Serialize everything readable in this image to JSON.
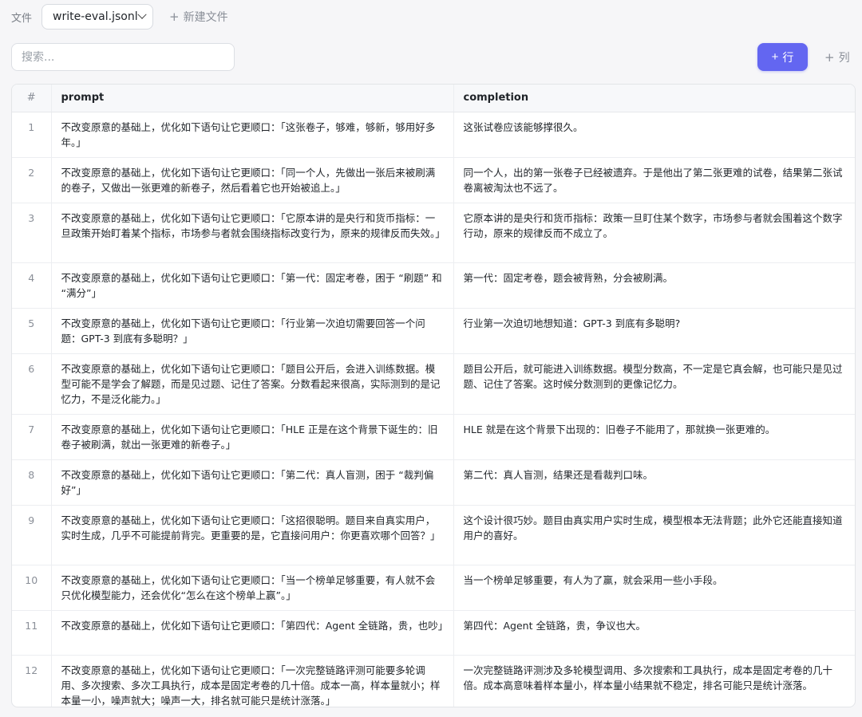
{
  "filebar": {
    "label": "文件",
    "selected_file": "write-eval.jsonl",
    "new_file_label": "新建文件"
  },
  "toolbar": {
    "search_placeholder": "搜索...",
    "add_row_label": "行",
    "add_col_label": "列"
  },
  "colors": {
    "accent": "#6366f1"
  },
  "table": {
    "headers": {
      "num": "#",
      "prompt": "prompt",
      "completion": "completion"
    },
    "rows": [
      {
        "num": "1",
        "prompt": "不改变原意的基础上，优化如下语句让它更顺口：「这张卷子，够难，够新，够用好多年。」",
        "completion": "这张试卷应该能够撑很久。"
      },
      {
        "num": "2",
        "prompt": "不改变原意的基础上，优化如下语句让它更顺口：「同一个人，先做出一张后来被刷满的卷子，又做出一张更难的新卷子，然后看着它也开始被追上。」",
        "completion": "同一个人，出的第一张卷子已经被遗弃。于是他出了第二张更难的试卷，结果第二张试卷离被淘汰也不远了。"
      },
      {
        "num": "3",
        "prompt": "不改变原意的基础上，优化如下语句让它更顺口：「它原本讲的是央行和货币指标：一旦政策开始盯着某个指标，市场参与者就会围绕指标改变行为，原来的规律反而失效。」",
        "completion": "它原本讲的是央行和货币指标：政策一旦盯住某个数字，市场参与者就会围着这个数字行动，原来的规律反而不成立了。"
      },
      {
        "num": "4",
        "prompt": "不改变原意的基础上，优化如下语句让它更顺口：「第一代：固定考卷，困于 “刷题” 和 “满分”」",
        "completion": "第一代：固定考卷，题会被背熟，分会被刷满。"
      },
      {
        "num": "5",
        "prompt": "不改变原意的基础上，优化如下语句让它更顺口：「行业第一次迫切需要回答一个问题：GPT-3 到底有多聪明？」",
        "completion": "行业第一次迫切地想知道：GPT-3 到底有多聪明?"
      },
      {
        "num": "6",
        "prompt": "不改变原意的基础上，优化如下语句让它更顺口：「题目公开后，会进入训练数据。模型可能不是学会了解题，而是见过题、记住了答案。分数看起来很高，实际测到的是记忆力，不是泛化能力。」",
        "completion": "题目公开后，就可能进入训练数据。模型分数高，不一定是它真会解，也可能只是见过题、记住了答案。这时候分数测到的更像记忆力。"
      },
      {
        "num": "7",
        "prompt": "不改变原意的基础上，优化如下语句让它更顺口：「HLE 正是在这个背景下诞生的：旧卷子被刷满，就出一张更难的新卷子。」",
        "completion": "HLE 就是在这个背景下出现的：旧卷子不能用了，那就换一张更难的。"
      },
      {
        "num": "8",
        "prompt": "不改变原意的基础上，优化如下语句让它更顺口：「第二代：真人盲测，困于 “裁判偏好”」",
        "completion": "第二代：真人盲测，结果还是看裁判口味。"
      },
      {
        "num": "9",
        "prompt": "不改变原意的基础上，优化如下语句让它更顺口：「这招很聪明。题目来自真实用户，实时生成，几乎不可能提前背完。更重要的是，它直接问用户：你更喜欢哪个回答？」",
        "completion": "这个设计很巧妙。题目由真实用户实时生成，模型根本无法背题；此外它还能直接知道用户的喜好。"
      },
      {
        "num": "10",
        "prompt": "不改变原意的基础上，优化如下语句让它更顺口：「当一个榜单足够重要，有人就不会只优化模型能力，还会优化“怎么在这个榜单上赢”。」",
        "completion": "当一个榜单足够重要，有人为了赢，就会采用一些小手段。"
      },
      {
        "num": "11",
        "prompt": "不改变原意的基础上，优化如下语句让它更顺口：「第四代：Agent 全链路，贵，也吵」",
        "completion": "第四代：Agent 全链路，贵，争议也大。"
      },
      {
        "num": "12",
        "prompt": "不改变原意的基础上，优化如下语句让它更顺口：「一次完整链路评测可能要多轮调用、多次搜索、多次工具执行，成本是固定考卷的几十倍。成本一高，样本量就小；样本量一小，噪声就大；噪声一大，排名就可能只是统计涨落。」",
        "completion": "一次完整链路评测涉及多轮模型调用、多次搜索和工具执行，成本是固定考卷的几十倍。成本高意味着样本量小，样本量小结果就不稳定，排名可能只是统计涨落。"
      }
    ]
  }
}
